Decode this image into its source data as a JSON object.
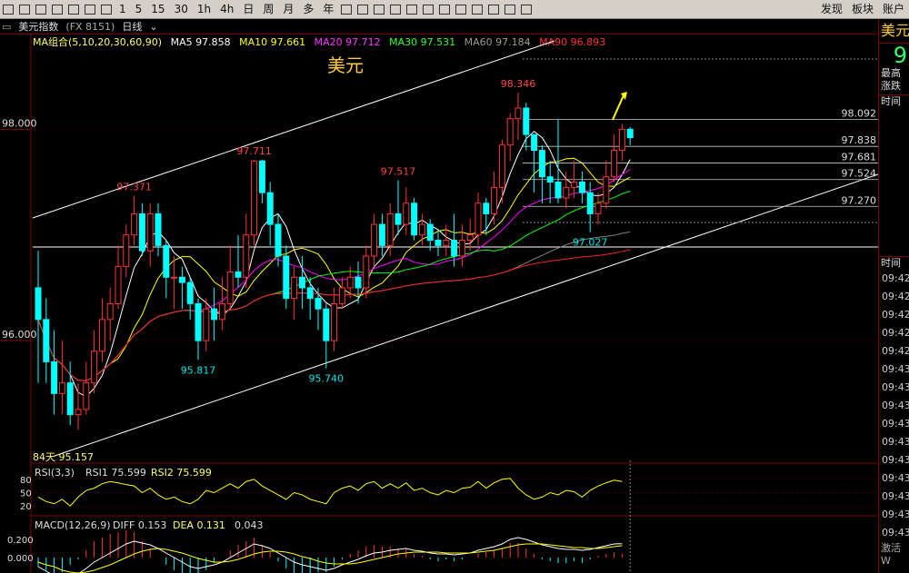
{
  "toolbar": {
    "periods": [
      "1",
      "5",
      "15",
      "30",
      "1h",
      "4h",
      "日",
      "周",
      "月",
      "多",
      "年"
    ],
    "right_items": [
      "发现",
      "板块",
      "账户"
    ]
  },
  "subbar": {
    "title": "美元指数",
    "code": "(FX 8151)",
    "period": "日线"
  },
  "legend": {
    "ma_group": "MA组合(5,10,20,30,60,90)",
    "ma5": "MA5 97.858",
    "ma10": "MA10 97.661",
    "ma20": "MA20 97.712",
    "ma30": "MA30 97.531",
    "ma60": "MA60 97.184",
    "ma90": "MA90 96.893"
  },
  "right_panel": {
    "title": "美元",
    "big_value": "9",
    "label_high": "最高",
    "label_change": "涨跌",
    "label_time": "时间",
    "label_time2": "时间",
    "times": [
      "09:42",
      "09:42",
      "09:42",
      "09:42",
      "09:42",
      "09:43",
      "09:43",
      "09:43",
      "09:43",
      "09:43",
      "09:43",
      "09:43",
      "09:43",
      "09:43",
      "09:43"
    ],
    "bottom_text": "激活 W"
  },
  "colors": {
    "up": "#ff3333",
    "down": "#00ffff",
    "ma5": "#ffffff",
    "ma10": "#ffff00",
    "ma20": "#ff00ff",
    "ma30": "#00ff00",
    "ma60": "#808080",
    "ma90": "#ff2020"
  },
  "chart_data": {
    "type": "candlestick",
    "title": "美元",
    "y_axis_labels": [
      "98.000",
      "96.000"
    ],
    "ylim": [
      94.85,
      98.75
    ],
    "candles": [
      [
        96.5,
        96.2,
        96.85,
        95.6
      ],
      [
        96.2,
        95.8,
        96.4,
        95.6
      ],
      [
        95.8,
        95.5,
        96.1,
        95.3
      ],
      [
        95.5,
        95.6,
        96.0,
        95.3
      ],
      [
        95.6,
        95.3,
        95.8,
        95.2
      ],
      [
        95.3,
        95.35,
        95.6,
        95.157
      ],
      [
        95.35,
        95.6,
        95.8,
        95.3
      ],
      [
        95.6,
        95.9,
        96.1,
        95.5
      ],
      [
        95.9,
        96.2,
        96.4,
        95.8
      ],
      [
        96.2,
        96.35,
        96.5,
        96.0
      ],
      [
        96.35,
        96.7,
        96.9,
        96.3
      ],
      [
        96.7,
        97.0,
        97.1,
        96.6
      ],
      [
        97.0,
        97.2,
        97.371,
        96.9
      ],
      [
        97.2,
        96.85,
        97.3,
        96.8
      ],
      [
        96.85,
        97.2,
        97.3,
        96.7
      ],
      [
        97.2,
        96.9,
        97.3,
        96.8
      ],
      [
        96.9,
        96.6,
        96.95,
        96.4
      ],
      [
        96.6,
        96.6,
        96.8,
        96.3
      ],
      [
        96.6,
        96.55,
        96.7,
        96.3
      ],
      [
        96.55,
        96.35,
        96.6,
        96.2
      ],
      [
        96.35,
        96.0,
        96.4,
        95.817
      ],
      [
        96.0,
        96.3,
        96.4,
        95.9
      ],
      [
        96.3,
        96.2,
        96.5,
        96.0
      ],
      [
        96.2,
        96.35,
        96.6,
        96.1
      ],
      [
        96.35,
        96.65,
        96.9,
        96.3
      ],
      [
        96.65,
        96.6,
        97.0,
        96.5
      ],
      [
        96.6,
        97.0,
        97.2,
        96.5
      ],
      [
        97.0,
        97.7,
        97.711,
        96.9
      ],
      [
        97.7,
        97.4,
        97.711,
        97.3
      ],
      [
        97.4,
        97.1,
        97.5,
        96.9
      ],
      [
        97.1,
        96.8,
        97.2,
        96.7
      ],
      [
        96.8,
        96.4,
        96.9,
        96.3
      ],
      [
        96.4,
        96.6,
        96.7,
        96.2
      ],
      [
        96.6,
        96.5,
        96.8,
        96.3
      ],
      [
        96.5,
        96.4,
        96.6,
        96.2
      ],
      [
        96.4,
        96.3,
        96.5,
        96.1
      ],
      [
        96.3,
        96.0,
        96.35,
        95.74
      ],
      [
        96.0,
        96.35,
        96.5,
        95.9
      ],
      [
        96.35,
        96.5,
        96.6,
        96.3
      ],
      [
        96.5,
        96.6,
        96.7,
        96.4
      ],
      [
        96.6,
        96.5,
        96.75,
        96.35
      ],
      [
        96.5,
        96.8,
        96.9,
        96.4
      ],
      [
        96.8,
        97.1,
        97.2,
        96.7
      ],
      [
        97.1,
        96.9,
        97.2,
        96.8
      ],
      [
        96.9,
        97.2,
        97.3,
        96.8
      ],
      [
        97.2,
        97.1,
        97.517,
        97.0
      ],
      [
        97.1,
        97.3,
        97.45,
        97.0
      ],
      [
        97.3,
        97.0,
        97.35,
        96.95
      ],
      [
        97.0,
        97.1,
        97.2,
        96.9
      ],
      [
        97.1,
        96.95,
        97.15,
        96.85
      ],
      [
        96.95,
        96.9,
        97.05,
        96.8
      ],
      [
        96.9,
        96.95,
        97.1,
        96.8
      ],
      [
        96.95,
        96.8,
        97.2,
        96.7
      ],
      [
        96.8,
        96.95,
        97.1,
        96.7
      ],
      [
        96.95,
        97.0,
        97.15,
        96.85
      ],
      [
        97.0,
        97.3,
        97.4,
        96.9
      ],
      [
        97.3,
        97.2,
        97.35,
        97.0
      ],
      [
        97.2,
        97.45,
        97.6,
        97.1
      ],
      [
        97.45,
        97.85,
        97.9,
        97.3
      ],
      [
        97.85,
        98.1,
        98.15,
        97.7
      ],
      [
        98.1,
        98.2,
        98.346,
        97.9
      ],
      [
        98.2,
        97.95,
        98.25,
        97.8
      ],
      [
        97.95,
        97.8,
        97.95,
        97.4
      ],
      [
        97.8,
        97.55,
        97.85,
        97.3
      ],
      [
        97.55,
        97.5,
        97.7,
        97.3
      ],
      [
        97.5,
        97.35,
        98.092,
        97.3
      ],
      [
        97.35,
        97.45,
        97.6,
        97.25
      ],
      [
        97.45,
        97.5,
        97.7,
        97.35
      ],
      [
        97.5,
        97.4,
        97.6,
        97.3
      ],
      [
        97.4,
        97.2,
        97.5,
        97.027
      ],
      [
        97.2,
        97.3,
        97.4,
        97.1
      ],
      [
        97.3,
        97.55,
        97.7,
        97.25
      ],
      [
        97.55,
        97.8,
        97.95,
        97.5
      ],
      [
        97.8,
        98.0,
        98.05,
        97.7
      ],
      [
        98.0,
        97.92,
        98.02,
        97.85
      ]
    ],
    "annotations": [
      {
        "text": "97.371",
        "x": 12,
        "y": 97.371,
        "color": "#ff4444",
        "pos": "above"
      },
      {
        "text": "97.711",
        "x": 27,
        "y": 97.711,
        "color": "#ff4444",
        "pos": "above"
      },
      {
        "text": "97.517",
        "x": 45,
        "y": 97.517,
        "color": "#ff4444",
        "pos": "above"
      },
      {
        "text": "98.346",
        "x": 60,
        "y": 98.346,
        "color": "#ff4444",
        "pos": "above"
      },
      {
        "text": "95.817",
        "x": 20,
        "y": 95.817,
        "color": "#00e5e5",
        "pos": "below"
      },
      {
        "text": "95.740",
        "x": 36,
        "y": 95.74,
        "color": "#00e5e5",
        "pos": "below"
      },
      {
        "text": "97.027",
        "x": 69,
        "y": 97.027,
        "color": "#00e5e5",
        "pos": "below"
      }
    ],
    "h_levels": [
      98.092,
      97.838,
      97.681,
      97.524,
      97.27
    ],
    "h_level_labels": [
      "98.092",
      "97.838",
      "97.681",
      "97.524",
      "97.270"
    ],
    "bottom_label": "84天 95.157",
    "watermark_title": "美元",
    "rsi": {
      "label": "RSI(3,3)",
      "rsi1": "RSI1 75.599",
      "rsi2": "RSI2 75.599",
      "ticks": [
        "80",
        "50",
        "20"
      ],
      "values": [
        40,
        30,
        25,
        35,
        20,
        40,
        55,
        60,
        70,
        75,
        72,
        68,
        65,
        50,
        60,
        45,
        35,
        40,
        30,
        25,
        35,
        55,
        50,
        60,
        70,
        60,
        75,
        80,
        65,
        55,
        45,
        35,
        50,
        45,
        35,
        30,
        25,
        50,
        60,
        65,
        55,
        70,
        75,
        60,
        70,
        60,
        72,
        55,
        60,
        50,
        45,
        55,
        50,
        60,
        62,
        75,
        60,
        72,
        80,
        82,
        60,
        45,
        35,
        40,
        50,
        45,
        55,
        52,
        40,
        55,
        65,
        72,
        78,
        75
      ]
    },
    "macd": {
      "label": "MACD(12,26,9)",
      "diff": "DIFF 0.153",
      "dea": "DEA 0.131",
      "macd": "0.043",
      "ticks": [
        "0.200",
        "0.000"
      ],
      "diff_values": [
        -0.1,
        -0.15,
        -0.2,
        -0.22,
        -0.2,
        -0.18,
        -0.12,
        -0.05,
        0.0,
        0.05,
        0.1,
        0.15,
        0.18,
        0.16,
        0.14,
        0.1,
        0.05,
        0.0,
        -0.05,
        -0.1,
        -0.12,
        -0.1,
        -0.08,
        -0.05,
        0.0,
        0.05,
        0.1,
        0.15,
        0.13,
        0.1,
        0.05,
        0.0,
        -0.05,
        -0.08,
        -0.1,
        -0.12,
        -0.14,
        -0.12,
        -0.08,
        -0.05,
        -0.02,
        0.02,
        0.05,
        0.06,
        0.08,
        0.09,
        0.1,
        0.08,
        0.07,
        0.05,
        0.04,
        0.04,
        0.03,
        0.04,
        0.05,
        0.08,
        0.1,
        0.12,
        0.15,
        0.2,
        0.22,
        0.2,
        0.17,
        0.14,
        0.12,
        0.1,
        0.09,
        0.09,
        0.08,
        0.09,
        0.11,
        0.13,
        0.15,
        0.153
      ],
      "dea_values": [
        -0.05,
        -0.08,
        -0.1,
        -0.14,
        -0.16,
        -0.17,
        -0.16,
        -0.14,
        -0.11,
        -0.08,
        -0.04,
        0.0,
        0.04,
        0.07,
        0.09,
        0.1,
        0.09,
        0.07,
        0.05,
        0.02,
        -0.01,
        -0.03,
        -0.05,
        -0.05,
        -0.04,
        -0.02,
        0.01,
        0.04,
        0.06,
        0.07,
        0.07,
        0.06,
        0.04,
        0.01,
        -0.01,
        -0.04,
        -0.06,
        -0.07,
        -0.07,
        -0.07,
        -0.06,
        -0.04,
        -0.02,
        0.0,
        0.02,
        0.04,
        0.05,
        0.06,
        0.06,
        0.06,
        0.06,
        0.05,
        0.05,
        0.05,
        0.05,
        0.06,
        0.07,
        0.08,
        0.1,
        0.12,
        0.14,
        0.15,
        0.15,
        0.15,
        0.14,
        0.13,
        0.12,
        0.11,
        0.11,
        0.1,
        0.1,
        0.11,
        0.12,
        0.131
      ]
    }
  }
}
